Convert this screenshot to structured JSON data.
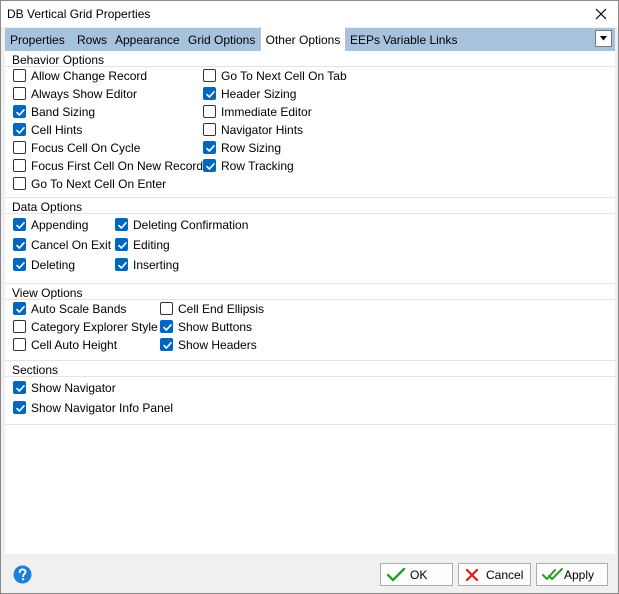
{
  "window": {
    "title": "DB Vertical Grid Properties"
  },
  "tabs": [
    {
      "label": "Properties"
    },
    {
      "label": "Rows"
    },
    {
      "label": "Appearance"
    },
    {
      "label": "Grid Options"
    },
    {
      "label": "Other Options"
    },
    {
      "label": "EEPs"
    },
    {
      "label": "Variable Links"
    }
  ],
  "active_tab": "Other Options",
  "groups": {
    "behavior": {
      "title": "Behavior Options",
      "items": [
        {
          "label": "Allow Change Record",
          "checked": false
        },
        {
          "label": "Always Show Editor",
          "checked": false
        },
        {
          "label": "Band Sizing",
          "checked": true
        },
        {
          "label": "Cell Hints",
          "checked": true
        },
        {
          "label": "Focus Cell On Cycle",
          "checked": false
        },
        {
          "label": "Focus First Cell On New Record",
          "checked": false
        },
        {
          "label": "Go To Next Cell On Enter",
          "checked": false
        },
        {
          "label": "Go To Next Cell On Tab",
          "checked": false
        },
        {
          "label": "Header Sizing",
          "checked": true
        },
        {
          "label": "Immediate Editor",
          "checked": false
        },
        {
          "label": "Navigator Hints",
          "checked": false
        },
        {
          "label": "Row Sizing",
          "checked": true
        },
        {
          "label": "Row Tracking",
          "checked": true
        }
      ]
    },
    "data": {
      "title": "Data Options",
      "items": [
        {
          "label": "Appending",
          "checked": true
        },
        {
          "label": "Cancel On Exit",
          "checked": true
        },
        {
          "label": "Deleting",
          "checked": true
        },
        {
          "label": "Deleting Confirmation",
          "checked": true
        },
        {
          "label": "Editing",
          "checked": true
        },
        {
          "label": "Inserting",
          "checked": true
        }
      ]
    },
    "view": {
      "title": "View Options",
      "items": [
        {
          "label": "Auto Scale Bands",
          "checked": true
        },
        {
          "label": "Category Explorer Style",
          "checked": false
        },
        {
          "label": "Cell Auto Height",
          "checked": false
        },
        {
          "label": "Cell End Ellipsis",
          "checked": false
        },
        {
          "label": "Show Buttons",
          "checked": true
        },
        {
          "label": "Show Headers",
          "checked": true
        }
      ]
    },
    "sections": {
      "title": "Sections",
      "items": [
        {
          "label": "Show Navigator",
          "checked": true
        },
        {
          "label": "Show Navigator Info Panel",
          "checked": true
        }
      ]
    }
  },
  "buttons": {
    "ok": "OK",
    "cancel": "Cancel",
    "apply": "Apply"
  },
  "icons": {
    "close": "close-icon",
    "dropdown": "chevron-down-icon",
    "help": "help-icon",
    "ok": "green-checkmark-icon",
    "cancel": "red-x-icon",
    "apply": "double-checkmark-icon"
  },
  "colors": {
    "tabbar": "#a6c2dd",
    "checkbox_checked": "#0067c0",
    "help": "#1e7fd6",
    "ok_check": "#2a9d2a",
    "cancel_x": "#d62020"
  }
}
